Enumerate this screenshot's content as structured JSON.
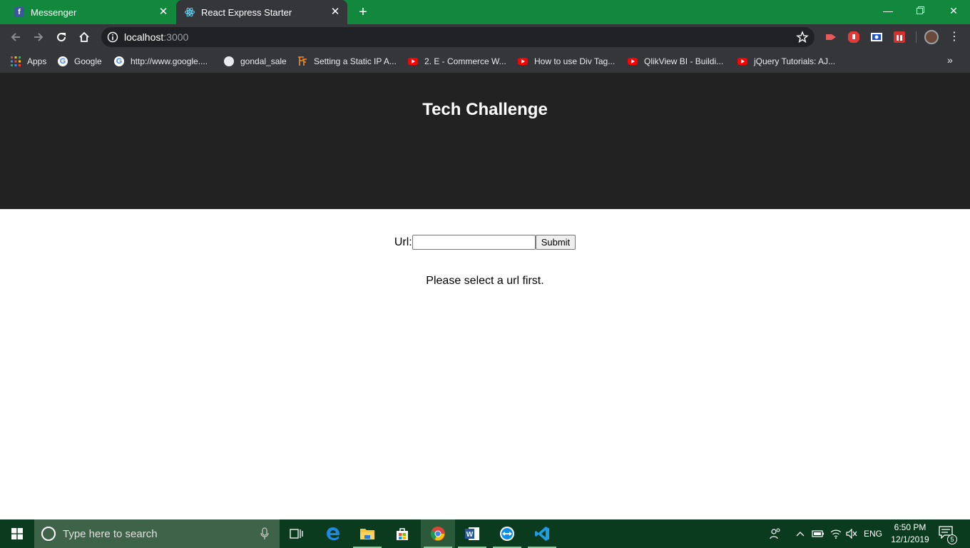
{
  "browser": {
    "tabs": [
      {
        "title": "Messenger",
        "favicon": "facebook-icon",
        "active": false
      },
      {
        "title": "React Express Starter",
        "favicon": "react-icon",
        "active": true
      }
    ],
    "address": {
      "host": "localhost",
      "port": ":3000"
    },
    "bookmarks": [
      {
        "label": "Apps",
        "icon": "apps-grid-icon"
      },
      {
        "label": "Google",
        "icon": "google-icon"
      },
      {
        "label": "http://www.google....",
        "icon": "google-icon"
      },
      {
        "label": "gondal_sale",
        "icon": "globe-icon"
      },
      {
        "label": "Setting a Static IP A...",
        "icon": "site-icon"
      },
      {
        "label": "2. E - Commerce W...",
        "icon": "youtube-icon"
      },
      {
        "label": "How to use Div Tag...",
        "icon": "youtube-icon"
      },
      {
        "label": "QlikView BI - Buildi...",
        "icon": "youtube-icon"
      },
      {
        "label": "jQuery Tutorials: AJ...",
        "icon": "youtube-icon"
      }
    ],
    "colors": {
      "tabstrip": "#11883c",
      "toolbar": "#35363a"
    }
  },
  "page": {
    "title": "Tech Challenge",
    "url_label": "Url:",
    "url_value": "",
    "submit_label": "Submit",
    "message": "Please select a url first."
  },
  "taskbar": {
    "search_placeholder": "Type here to search",
    "language": "ENG",
    "time": "6:50 PM",
    "date": "12/1/2019",
    "notification_count": "5"
  }
}
